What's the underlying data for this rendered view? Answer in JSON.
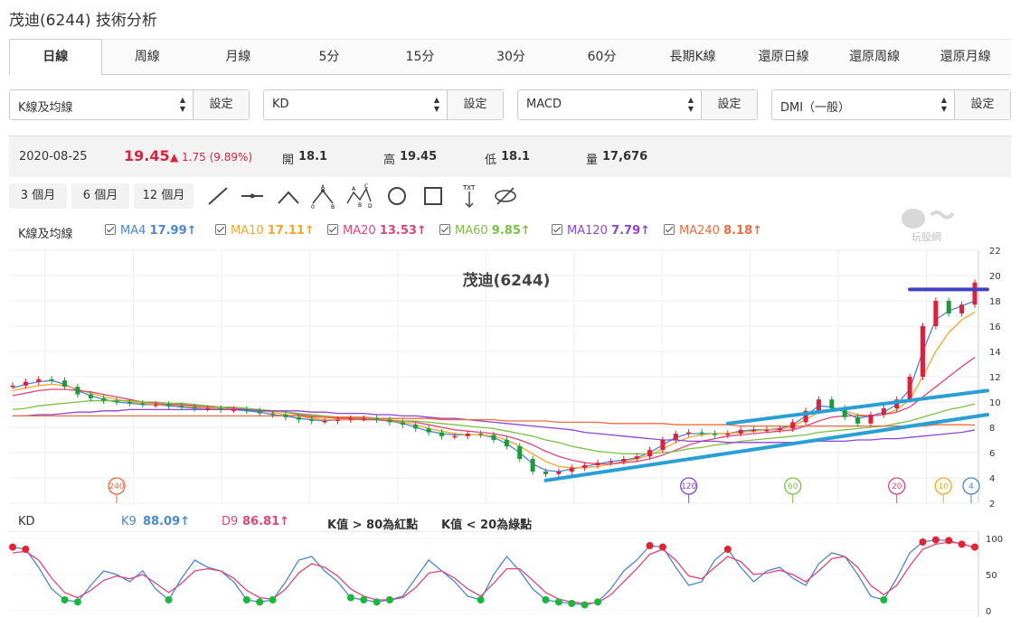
{
  "page_title": "茂迪(6244) 技術分析",
  "tabs": [
    "日線",
    "周線",
    "月線",
    "5分",
    "15分",
    "30分",
    "60分",
    "長期K線",
    "還原日線",
    "還原周線",
    "還原月線"
  ],
  "selectors": [
    {
      "value": "K線及均線",
      "button": "設定"
    },
    {
      "value": "KD",
      "button": "設定"
    },
    {
      "value": "MACD",
      "button": "設定"
    },
    {
      "value": "DMI（一般）",
      "button": "設定"
    }
  ],
  "quote": {
    "date": "2020-08-25",
    "price": "19.45",
    "change": "▲ 1.75 (9.89%)",
    "open_label": "開",
    "open": "18.1",
    "high_label": "高",
    "high": "19.45",
    "low_label": "低",
    "low": "18.1",
    "volume_label": "量",
    "volume": "17,676"
  },
  "periods": [
    "3 個月",
    "6 個月",
    "12 個月"
  ],
  "tools": [
    "line-tool-icon",
    "segment-tool-icon",
    "angle-tool-icon",
    "abc-tool-icon",
    "abcd-tool-icon",
    "circle-tool-icon",
    "rectangle-tool-icon",
    "text-tool-icon",
    "hide-tool-icon"
  ],
  "tool_glyph_labels": {
    "a": "A",
    "b": "B",
    "c": "C",
    "d": "D",
    "zero": "0",
    "txt": "TXT"
  },
  "watermark": "玩股網",
  "ma_legend": {
    "label": "K線及均線",
    "items": [
      {
        "name": "MA4",
        "value": "17.99↑",
        "color": "#4a86d8"
      },
      {
        "name": "MA10",
        "value": "17.11↑",
        "color": "#f5a623"
      },
      {
        "name": "MA20",
        "value": "13.53↑",
        "color": "#e0457b"
      },
      {
        "name": "MA60",
        "value": "9.85↑",
        "color": "#7cc242"
      },
      {
        "name": "MA120",
        "value": "7.79↑",
        "color": "#8e44d6"
      },
      {
        "name": "MA240",
        "value": "8.18↑",
        "color": "#f06b3c"
      }
    ]
  },
  "chart_data": [
    {
      "type": "line",
      "title": "茂迪(6244)",
      "ylim": [
        2,
        22
      ],
      "yticks": [
        2,
        4,
        6,
        8,
        10,
        12,
        14,
        16,
        18,
        20,
        22
      ],
      "series": [
        {
          "name": "K",
          "color": "#444444",
          "values": [
            11.3,
            11.6,
            11.8,
            11.7,
            11.2,
            10.6,
            10.3,
            10.1,
            10.0,
            9.9,
            9.8,
            9.8,
            9.7,
            9.6,
            9.5,
            9.5,
            9.4,
            9.4,
            9.3,
            9.1,
            9.0,
            8.8,
            8.6,
            8.5,
            8.5,
            8.6,
            8.7,
            8.7,
            8.6,
            8.4,
            8.2,
            7.9,
            7.6,
            7.3,
            7.3,
            7.5,
            7.4,
            7.0,
            6.5,
            5.5,
            4.5,
            4.3,
            4.5,
            4.8,
            5.0,
            5.2,
            5.3,
            5.5,
            5.7,
            6.2,
            7.0,
            7.5,
            7.6,
            7.5,
            7.4,
            7.5,
            7.8,
            7.8,
            7.8,
            7.9,
            8.4,
            9.3,
            10.2,
            9.5,
            8.8,
            8.3,
            9.0,
            9.5,
            10.2,
            12.0,
            16.0,
            18.0,
            17.0,
            17.7,
            19.45
          ]
        },
        {
          "name": "MA4",
          "color": "#4a86d8",
          "values": [
            11.1,
            11.4,
            11.6,
            11.7,
            11.4,
            10.9,
            10.5,
            10.2,
            10.0,
            9.9,
            9.8,
            9.8,
            9.7,
            9.6,
            9.5,
            9.5,
            9.4,
            9.4,
            9.3,
            9.2,
            9.0,
            8.9,
            8.7,
            8.6,
            8.5,
            8.6,
            8.6,
            8.7,
            8.6,
            8.5,
            8.3,
            8.0,
            7.7,
            7.5,
            7.4,
            7.4,
            7.4,
            7.2,
            6.7,
            6.0,
            5.1,
            4.6,
            4.5,
            4.7,
            4.9,
            5.1,
            5.3,
            5.4,
            5.6,
            6.0,
            6.6,
            7.2,
            7.5,
            7.5,
            7.5,
            7.5,
            7.7,
            7.8,
            7.8,
            7.9,
            8.2,
            8.9,
            9.7,
            9.6,
            9.2,
            8.7,
            8.9,
            9.2,
            9.8,
            11.0,
            14.0,
            16.5,
            17.2,
            17.6,
            17.99
          ]
        },
        {
          "name": "MA10",
          "color": "#f5a623",
          "values": [
            10.9,
            11.1,
            11.3,
            11.4,
            11.3,
            11.0,
            10.7,
            10.4,
            10.2,
            10.0,
            9.9,
            9.8,
            9.8,
            9.7,
            9.6,
            9.5,
            9.5,
            9.4,
            9.4,
            9.3,
            9.2,
            9.0,
            8.9,
            8.7,
            8.6,
            8.6,
            8.6,
            8.6,
            8.6,
            8.5,
            8.4,
            8.2,
            7.9,
            7.7,
            7.5,
            7.4,
            7.4,
            7.3,
            7.0,
            6.5,
            5.9,
            5.3,
            4.9,
            4.8,
            4.8,
            4.9,
            5.1,
            5.3,
            5.5,
            5.8,
            6.3,
            6.8,
            7.2,
            7.4,
            7.5,
            7.5,
            7.6,
            7.7,
            7.8,
            7.8,
            8.1,
            8.6,
            9.2,
            9.4,
            9.3,
            9.0,
            8.9,
            9.0,
            9.4,
            10.2,
            12.0,
            14.0,
            15.5,
            16.5,
            17.11
          ]
        },
        {
          "name": "MA20",
          "color": "#e0457b",
          "values": [
            10.5,
            10.7,
            10.9,
            11.0,
            11.0,
            10.9,
            10.8,
            10.6,
            10.4,
            10.2,
            10.0,
            9.9,
            9.8,
            9.8,
            9.7,
            9.6,
            9.6,
            9.5,
            9.4,
            9.4,
            9.3,
            9.2,
            9.0,
            8.9,
            8.8,
            8.7,
            8.7,
            8.6,
            8.6,
            8.5,
            8.5,
            8.4,
            8.2,
            8.0,
            7.8,
            7.7,
            7.6,
            7.5,
            7.3,
            7.0,
            6.6,
            6.1,
            5.7,
            5.4,
            5.2,
            5.1,
            5.1,
            5.2,
            5.3,
            5.5,
            5.8,
            6.2,
            6.6,
            6.9,
            7.1,
            7.3,
            7.4,
            7.5,
            7.6,
            7.7,
            7.8,
            8.1,
            8.5,
            8.8,
            8.9,
            8.9,
            8.9,
            9.0,
            9.2,
            9.6,
            10.4,
            11.2,
            12.0,
            12.8,
            13.53
          ]
        },
        {
          "name": "MA60",
          "color": "#7cc242",
          "values": [
            9.4,
            9.5,
            9.7,
            9.8,
            9.9,
            10.0,
            10.1,
            10.1,
            10.1,
            10.1,
            10.0,
            10.0,
            9.9,
            9.9,
            9.8,
            9.7,
            9.6,
            9.6,
            9.5,
            9.4,
            9.3,
            9.2,
            9.1,
            9.0,
            8.9,
            8.8,
            8.8,
            8.7,
            8.7,
            8.6,
            8.5,
            8.5,
            8.4,
            8.3,
            8.2,
            8.1,
            8.0,
            7.9,
            7.7,
            7.5,
            7.3,
            7.0,
            6.8,
            6.5,
            6.3,
            6.1,
            6.0,
            5.9,
            5.9,
            5.9,
            6.0,
            6.1,
            6.3,
            6.4,
            6.6,
            6.7,
            6.9,
            7.0,
            7.1,
            7.2,
            7.3,
            7.4,
            7.6,
            7.7,
            7.8,
            7.9,
            8.0,
            8.1,
            8.3,
            8.5,
            8.8,
            9.1,
            9.4,
            9.6,
            9.85
          ]
        },
        {
          "name": "MA120",
          "color": "#8e44d6",
          "values": [
            8.9,
            8.9,
            9.0,
            9.0,
            9.1,
            9.2,
            9.2,
            9.3,
            9.3,
            9.4,
            9.4,
            9.4,
            9.4,
            9.4,
            9.4,
            9.4,
            9.4,
            9.4,
            9.4,
            9.3,
            9.3,
            9.3,
            9.3,
            9.2,
            9.2,
            9.1,
            9.1,
            9.1,
            9.0,
            9.0,
            8.9,
            8.9,
            8.8,
            8.7,
            8.7,
            8.6,
            8.5,
            8.4,
            8.3,
            8.2,
            8.1,
            8.0,
            7.9,
            7.8,
            7.6,
            7.5,
            7.4,
            7.3,
            7.2,
            7.1,
            7.0,
            7.0,
            6.9,
            6.9,
            6.9,
            6.8,
            6.8,
            6.8,
            6.8,
            6.8,
            6.8,
            6.8,
            6.9,
            6.9,
            6.9,
            7.0,
            7.0,
            7.1,
            7.1,
            7.2,
            7.3,
            7.4,
            7.5,
            7.6,
            7.79
          ]
        },
        {
          "name": "MA240",
          "color": "#f06b3c",
          "values": [
            8.9,
            8.9,
            8.9,
            8.9,
            8.9,
            8.9,
            8.9,
            8.9,
            8.9,
            8.9,
            8.9,
            8.9,
            8.9,
            8.9,
            8.9,
            8.9,
            8.9,
            8.9,
            8.9,
            8.9,
            8.9,
            8.9,
            8.9,
            8.8,
            8.8,
            8.8,
            8.8,
            8.8,
            8.7,
            8.7,
            8.7,
            8.7,
            8.7,
            8.6,
            8.6,
            8.6,
            8.6,
            8.6,
            8.5,
            8.5,
            8.5,
            8.5,
            8.4,
            8.4,
            8.4,
            8.4,
            8.3,
            8.3,
            8.3,
            8.3,
            8.3,
            8.2,
            8.2,
            8.2,
            8.2,
            8.2,
            8.1,
            8.1,
            8.1,
            8.1,
            8.1,
            8.1,
            8.1,
            8.1,
            8.1,
            8.1,
            8.1,
            8.1,
            8.1,
            8.1,
            8.1,
            8.2,
            8.2,
            8.2,
            8.18
          ]
        }
      ],
      "ma_markers": [
        "240",
        "120",
        "60",
        "20",
        "10",
        "4"
      ],
      "annotations": [
        {
          "kind": "trendline",
          "color": "#2a9fd6",
          "from": [
            55,
            8.3
          ],
          "to": [
            74,
            10.9
          ]
        },
        {
          "kind": "trendline",
          "color": "#2a9fd6",
          "from": [
            41,
            3.8
          ],
          "to": [
            74,
            9.0
          ]
        },
        {
          "kind": "resistance",
          "color": "#4040c0",
          "from": [
            69,
            18.9
          ],
          "to": [
            74,
            18.9
          ]
        }
      ]
    },
    {
      "type": "line",
      "title": "KD",
      "ylim": [
        0,
        100
      ],
      "yticks": [
        0,
        50,
        100
      ],
      "series": [
        {
          "name": "K9",
          "color": "#4a86d8",
          "values": [
            88,
            85,
            60,
            30,
            15,
            12,
            35,
            55,
            50,
            40,
            55,
            30,
            15,
            45,
            70,
            60,
            55,
            40,
            15,
            12,
            15,
            40,
            70,
            75,
            55,
            40,
            18,
            15,
            12,
            15,
            20,
            45,
            70,
            55,
            40,
            20,
            15,
            50,
            75,
            55,
            30,
            15,
            12,
            10,
            8,
            12,
            30,
            55,
            70,
            90,
            88,
            60,
            35,
            40,
            70,
            85,
            60,
            40,
            55,
            60,
            45,
            35,
            65,
            80,
            75,
            50,
            20,
            15,
            45,
            80,
            95,
            98,
            97,
            92,
            88
          ]
        },
        {
          "name": "D9",
          "color": "#e0457b",
          "values": [
            80,
            82,
            70,
            45,
            25,
            18,
            28,
            42,
            48,
            44,
            50,
            38,
            25,
            38,
            55,
            58,
            55,
            45,
            28,
            18,
            16,
            30,
            52,
            65,
            60,
            48,
            30,
            20,
            15,
            15,
            18,
            32,
            52,
            55,
            45,
            30,
            20,
            38,
            58,
            58,
            42,
            25,
            16,
            12,
            10,
            11,
            22,
            40,
            58,
            78,
            85,
            70,
            48,
            44,
            60,
            75,
            68,
            50,
            52,
            56,
            50,
            40,
            55,
            72,
            75,
            60,
            35,
            22,
            35,
            62,
            85,
            92,
            95,
            93,
            86.81
          ]
        }
      ]
    }
  ],
  "kd_legend": {
    "label": "KD",
    "k_name": "K9",
    "k_value": "88.09↑",
    "d_name": "D9",
    "d_value": "86.81↑",
    "note_red": "K值 > 80為紅點",
    "note_green": "K值 < 20為綠點"
  }
}
